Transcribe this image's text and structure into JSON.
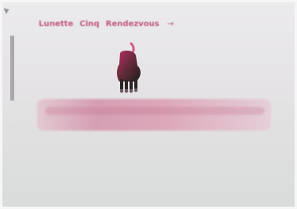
{
  "breadcrumb": {
    "items": [
      "Lunette",
      "Cinq",
      "Rendezvous"
    ],
    "separator": "→"
  },
  "colors": {
    "accent": "#c05a7f",
    "background": "#ece9ea",
    "banner": "#d59fb3",
    "dark_figure": "#2b2526"
  },
  "icons": {
    "hero": "animal-figure-icon",
    "scroll": "scrollbar-thumb"
  }
}
